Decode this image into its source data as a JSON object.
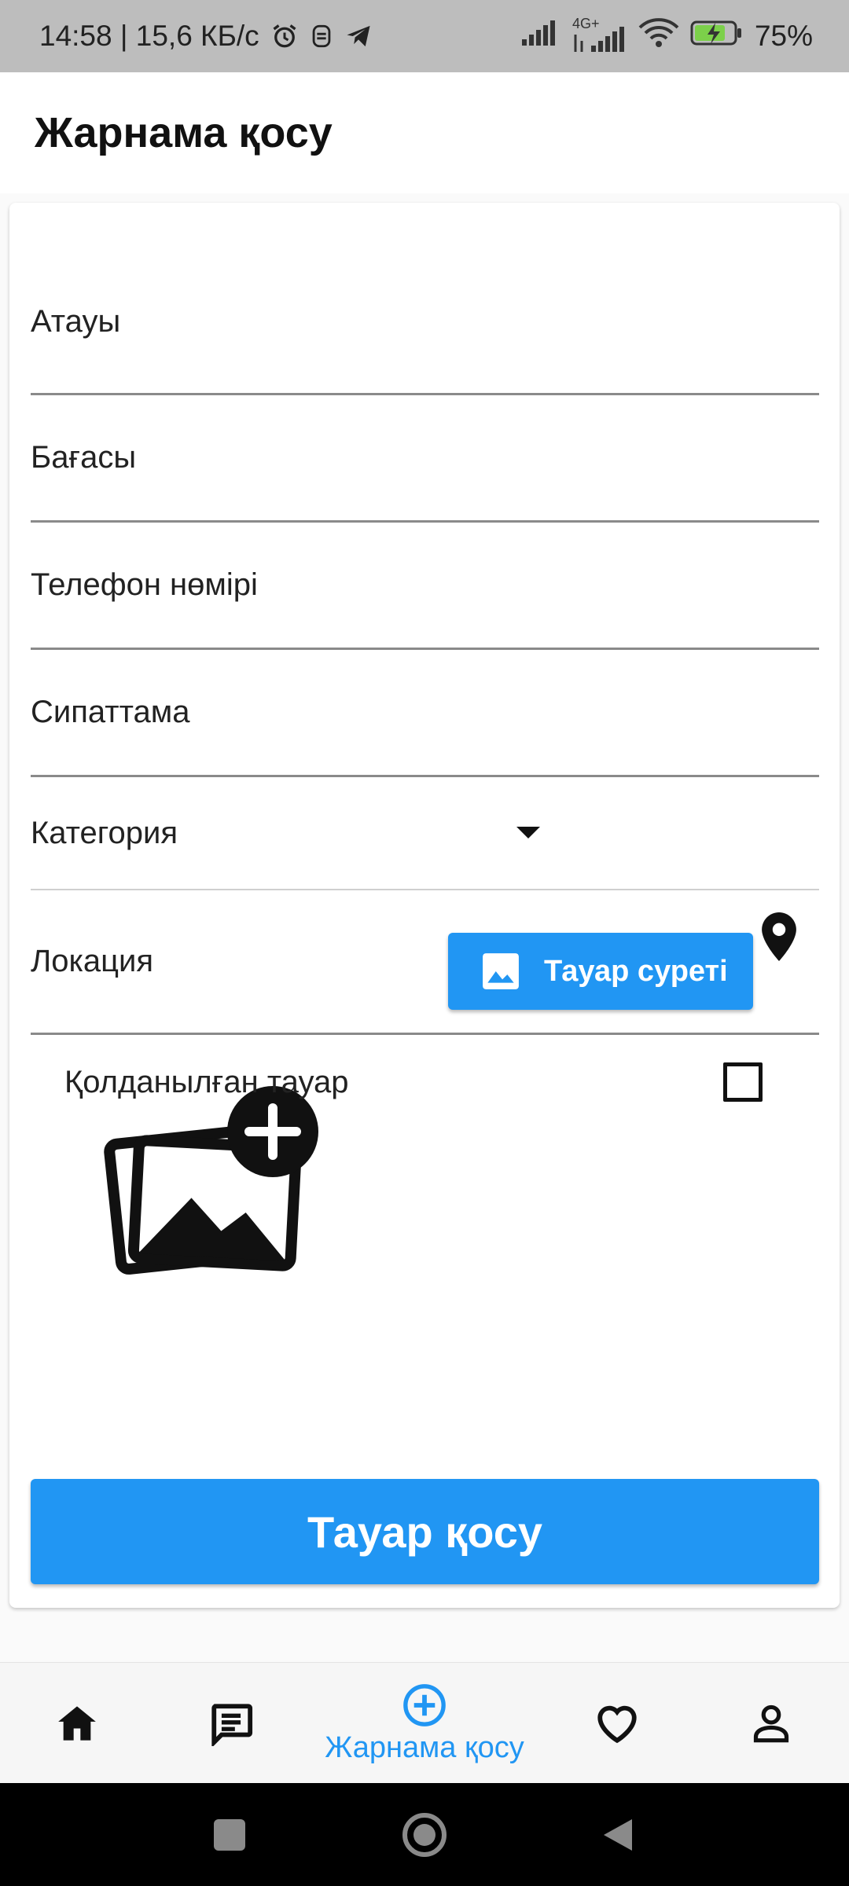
{
  "status_bar": {
    "time_speed": "14:58 | 15,6 КБ/с",
    "network": "4G+",
    "battery": "75%"
  },
  "app_bar": {
    "title": "Жарнама қосу"
  },
  "form": {
    "fields": [
      {
        "label": "Атауы"
      },
      {
        "label": "Бағасы"
      },
      {
        "label": "Телефон нөмірі"
      },
      {
        "label": "Сипаттама"
      }
    ],
    "category": {
      "label": "Категория"
    },
    "location": {
      "label": "Локация"
    },
    "photo_button": {
      "label": "Тауар суреті"
    },
    "used_item": {
      "label": "Қолданылған тауар",
      "checked": false
    },
    "submit_button": {
      "label": "Тауар қосу"
    }
  },
  "bottom_nav": {
    "items": [
      {
        "icon": "home-icon"
      },
      {
        "icon": "chat-icon"
      },
      {
        "icon": "add-circle-icon",
        "label": "Жарнама қосу",
        "active": true
      },
      {
        "icon": "heart-icon"
      },
      {
        "icon": "person-icon"
      }
    ]
  },
  "colors": {
    "accent": "#2196f3",
    "status_bar": "#bdbdbd",
    "system_nav": "#000000"
  }
}
